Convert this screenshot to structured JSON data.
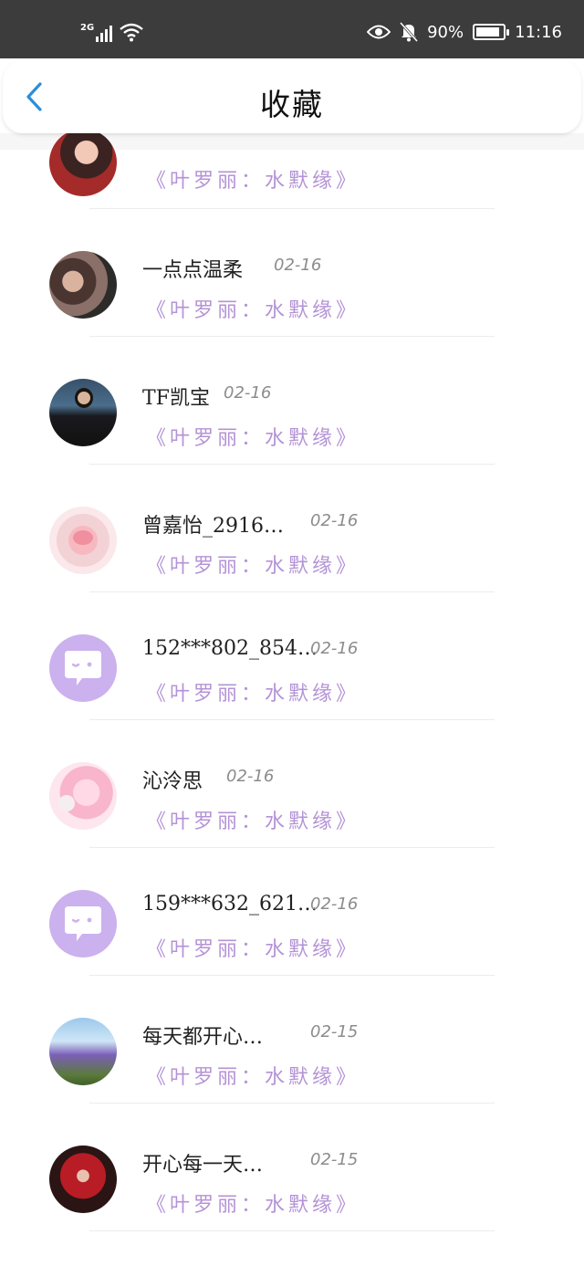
{
  "status_bar": {
    "network_type": "2G",
    "battery_percent": "90%",
    "battery_level": 0.9,
    "time": "11:16"
  },
  "header": {
    "title": "收藏",
    "back_icon": "chevron-left-icon"
  },
  "colors": {
    "accent": "#2b8ed8",
    "book_title": "#b493d6",
    "default_avatar": "#cbb1ee"
  },
  "items": [
    {
      "name": "",
      "date": "",
      "book": "《叶罗丽：水默缘》"
    },
    {
      "name": "一点点温柔",
      "date": "02-16",
      "book": "《叶罗丽：水默缘》"
    },
    {
      "name": "TF凯宝",
      "date": "02-16",
      "book": "《叶罗丽：水默缘》"
    },
    {
      "name": "曾嘉怡_2916…",
      "date": "02-16",
      "book": "《叶罗丽：水默缘》"
    },
    {
      "name": "152***802_854…",
      "date": "02-16",
      "book": "《叶罗丽：水默缘》"
    },
    {
      "name": "沁泠思",
      "date": "02-16",
      "book": "《叶罗丽：水默缘》"
    },
    {
      "name": "159***632_621…",
      "date": "02-16",
      "book": "《叶罗丽：水默缘》"
    },
    {
      "name": "每天都开心…",
      "date": "02-15",
      "book": "《叶罗丽：水默缘》"
    },
    {
      "name": "开心每一天…",
      "date": "02-15",
      "book": "《叶罗丽：水默缘》"
    }
  ]
}
